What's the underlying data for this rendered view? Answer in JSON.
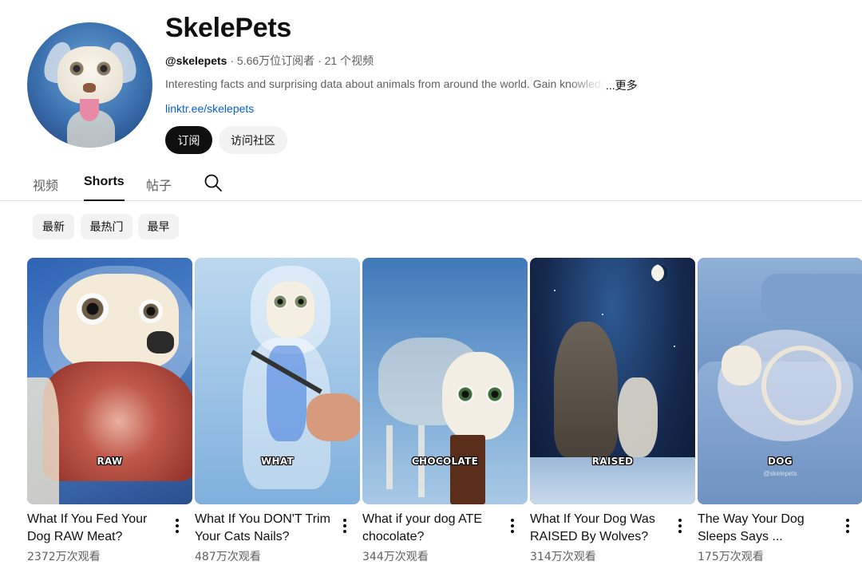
{
  "channel": {
    "name": "SkelePets",
    "handle": "@skelepets",
    "subscribers": " · 5.66万位订阅者",
    "video_count": " · 21 个视频",
    "description": "Interesting facts and surprising data about animals from around the world. Gain knowledge",
    "more_label": "...更多",
    "link": "linktr.ee/skelepets"
  },
  "buttons": {
    "subscribe": "订阅",
    "community": "访问社区"
  },
  "tabs": {
    "videos": "视频",
    "shorts": "Shorts",
    "posts": "帖子"
  },
  "chips": [
    "最新",
    "最热门",
    "最早"
  ],
  "shorts": [
    {
      "caption": "RAW",
      "watermark": "",
      "title": "What If You Fed Your Dog RAW Meat?",
      "views": "2372万次观看"
    },
    {
      "caption": "WHAT",
      "watermark": "",
      "title": "What If You DON'T Trim Your Cats Nails?",
      "views": "487万次观看"
    },
    {
      "caption": "CHOCOLATE",
      "watermark": "",
      "title": "What if your dog ATE chocolate?",
      "views": "344万次观看"
    },
    {
      "caption": "RAISED",
      "watermark": "",
      "title": "What If Your Dog Was RAISED By Wolves?",
      "views": "314万次观看"
    },
    {
      "caption": "DOG",
      "watermark": "@skelepets",
      "title": "The Way Your Dog Sleeps Says ...",
      "views": "175万次观看"
    }
  ],
  "icons": {
    "search": "search-icon",
    "more": "more-vert-icon"
  }
}
